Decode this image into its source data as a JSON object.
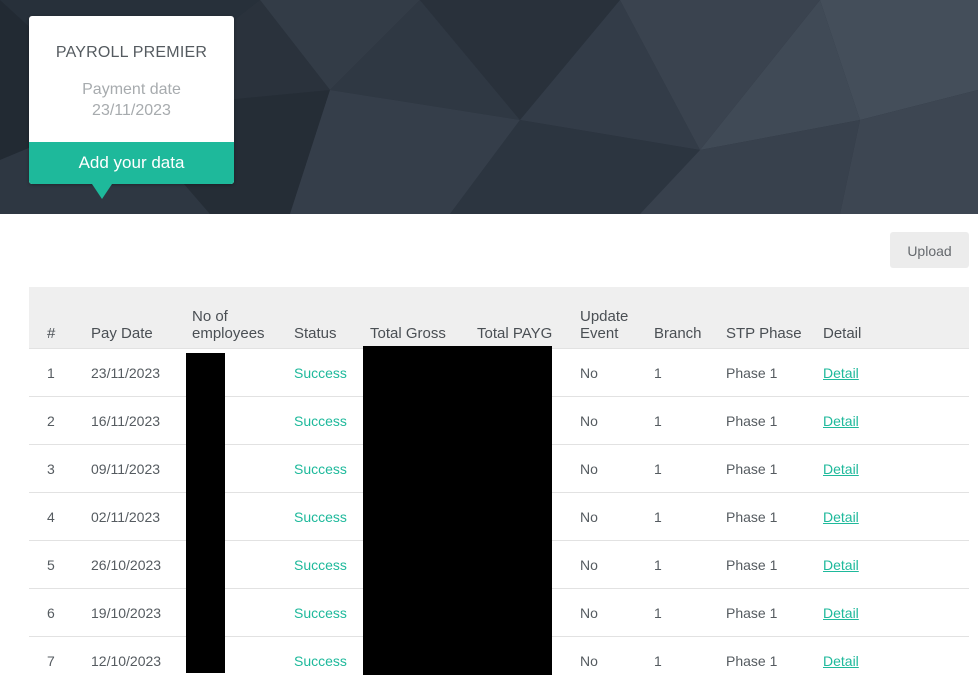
{
  "card": {
    "title": "PAYROLL PREMIER",
    "payment_date_label": "Payment date",
    "payment_date": "23/11/2023",
    "cta_label": "Add your data"
  },
  "toolbar": {
    "upload_label": "Upload"
  },
  "table": {
    "headers": {
      "num": "#",
      "pay_date": "Pay Date",
      "employees_line1": "No of",
      "employees_line2": "employees",
      "status": "Status",
      "total_gross": "Total Gross",
      "total_payg": "Total PAYG",
      "update_line1": "Update",
      "update_line2": "Event",
      "branch": "Branch",
      "stp_phase": "STP Phase",
      "detail": "Detail"
    },
    "rows": [
      {
        "num": "1",
        "pay_date": "23/11/2023",
        "status": "Success",
        "update_event": "No",
        "branch": "1",
        "stp_phase": "Phase 1",
        "detail": "Detail"
      },
      {
        "num": "2",
        "pay_date": "16/11/2023",
        "status": "Success",
        "update_event": "No",
        "branch": "1",
        "stp_phase": "Phase 1",
        "detail": "Detail"
      },
      {
        "num": "3",
        "pay_date": "09/11/2023",
        "status": "Success",
        "update_event": "No",
        "branch": "1",
        "stp_phase": "Phase 1",
        "detail": "Detail"
      },
      {
        "num": "4",
        "pay_date": "02/11/2023",
        "status": "Success",
        "update_event": "No",
        "branch": "1",
        "stp_phase": "Phase 1",
        "detail": "Detail"
      },
      {
        "num": "5",
        "pay_date": "26/10/2023",
        "status": "Success",
        "update_event": "No",
        "branch": "1",
        "stp_phase": "Phase 1",
        "detail": "Detail"
      },
      {
        "num": "6",
        "pay_date": "19/10/2023",
        "status": "Success",
        "update_event": "No",
        "branch": "1",
        "stp_phase": "Phase 1",
        "detail": "Detail"
      },
      {
        "num": "7",
        "pay_date": "12/10/2023",
        "status": "Success",
        "update_event": "No",
        "branch": "1",
        "stp_phase": "Phase 1",
        "detail": "Detail"
      }
    ]
  },
  "colors": {
    "accent": "#1eb99b",
    "hero_bg": "#2b333d"
  }
}
